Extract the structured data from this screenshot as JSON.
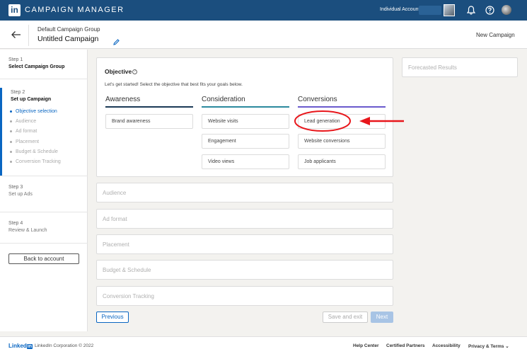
{
  "topbar": {
    "logo": "in",
    "title": "CAMPAIGN MANAGER",
    "account": "Individual Account"
  },
  "header": {
    "group": "Default Campaign Group",
    "campaign": "Untitled Campaign",
    "new_campaign": "New Campaign"
  },
  "sidebar": {
    "step1": {
      "label": "Step 1",
      "title": "Select Campaign Group"
    },
    "step2": {
      "label": "Step 2",
      "title": "Set up Campaign"
    },
    "substeps": [
      "Objective selection",
      "Audience",
      "Ad format",
      "Placement",
      "Budget & Schedule",
      "Conversion Tracking"
    ],
    "step3": {
      "label": "Step 3",
      "title": "Set up Ads"
    },
    "step4": {
      "label": "Step 4",
      "title": "Review & Launch"
    },
    "back_button": "Back to account"
  },
  "objective": {
    "title": "Objective",
    "help": "?",
    "description": "Let's get started! Select the objective that best fits your goals below.",
    "columns": [
      {
        "title": "Awareness",
        "color": "#1b3a57",
        "options": [
          "Brand awareness"
        ]
      },
      {
        "title": "Consideration",
        "color": "#2b8a9e",
        "options": [
          "Website visits",
          "Engagement",
          "Video views"
        ]
      },
      {
        "title": "Conversions",
        "color": "#6a5acd",
        "options": [
          "Lead generation",
          "Website conversions",
          "Job applicants"
        ]
      }
    ]
  },
  "sections": [
    "Audience",
    "Ad format",
    "Placement",
    "Budget & Schedule",
    "Conversion Tracking"
  ],
  "actions": {
    "previous": "Previous",
    "save_exit": "Save and exit",
    "next": "Next"
  },
  "forecast": {
    "title": "Forecasted Results"
  },
  "footer": {
    "logo_text": "Linked",
    "logo_in": "in",
    "copyright": "LinkedIn Corporation © 2022",
    "links": [
      "Help Center",
      "Certified Partners",
      "Accessibility",
      "Privacy & Terms"
    ]
  },
  "colors": {
    "brand": "#1b4e7e",
    "accent": "#0a66c2",
    "annotation": "#e8161b"
  }
}
